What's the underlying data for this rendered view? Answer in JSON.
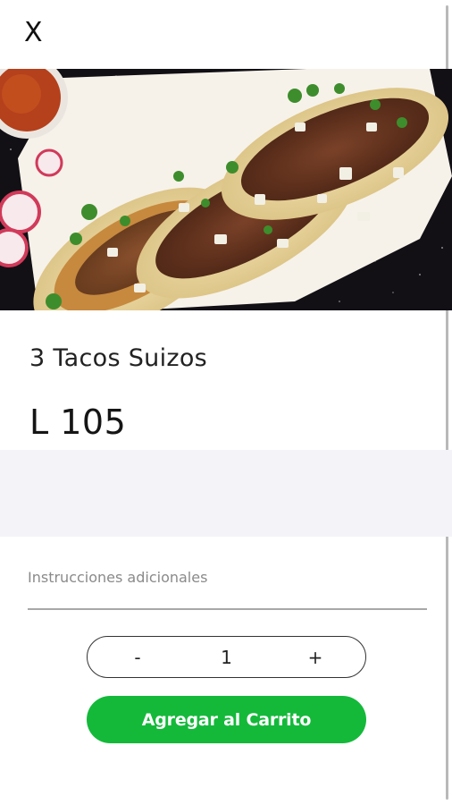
{
  "header": {
    "close_label": "X"
  },
  "product": {
    "name": "3 Tacos Suizos",
    "price": "L 105",
    "image_alt": "Plate of three tacos with meat, onion and cilantro"
  },
  "instructions": {
    "placeholder": "Instrucciones adicionales",
    "value": ""
  },
  "quantity": {
    "decrement_label": "-",
    "value": "1",
    "increment_label": "+"
  },
  "cart": {
    "add_label": "Agregar al Carrito"
  },
  "colors": {
    "primary_green": "#14b93a",
    "band_gray": "#f4f4f8"
  }
}
